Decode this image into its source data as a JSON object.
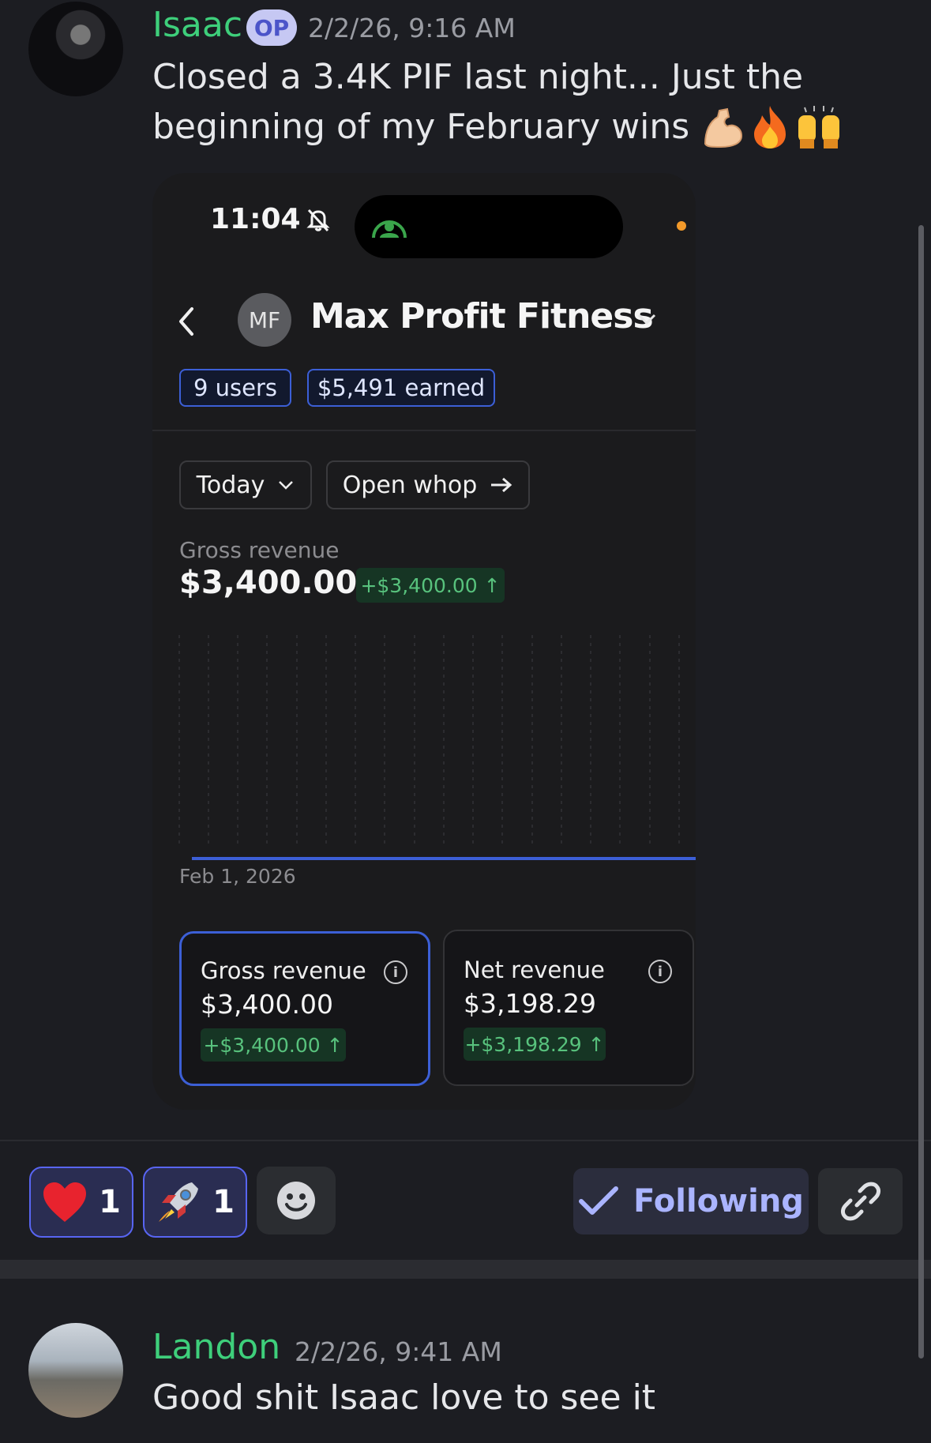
{
  "post": {
    "author": "Isaac",
    "op_badge": "OP",
    "timestamp": "2/2/26, 9:16 AM",
    "text_line1": "Closed a 3.4K PIF last night... Just the",
    "text_line2": "beginning of my February wins",
    "emojis": [
      "flexed-biceps",
      "fire",
      "raising-hands"
    ]
  },
  "phone": {
    "status_time": "11:04",
    "status_icons": [
      "bell-slash-icon",
      "broadcast-icon",
      "recording-dot"
    ],
    "avatar_initials": "MF",
    "business_name": "Max Profit Fitness",
    "users_tag": "9 users",
    "earned_tag": "$5,491 earned",
    "period_dropdown": "Today",
    "open_button": "Open whop",
    "gross_label": "Gross revenue",
    "gross_value": "$3,400.00",
    "gross_change": "+$3,400.00 ↑",
    "chart_date": "Feb 1, 2026",
    "card_gross": {
      "label": "Gross revenue",
      "value": "$3,400.00",
      "change": "+$3,400.00 ↑"
    },
    "card_net": {
      "label": "Net revenue",
      "value": "$3,198.29",
      "change": "+$3,198.29 ↑"
    },
    "colors": {
      "accent": "#3c5fd6",
      "positive": "#58c27d",
      "background": "#1b1b1d"
    }
  },
  "reactions": [
    {
      "emoji": "heart",
      "count": "1"
    },
    {
      "emoji": "rocket",
      "count": "1"
    }
  ],
  "actions": {
    "following_label": "Following"
  },
  "reply": {
    "author": "Landon",
    "timestamp": "2/2/26, 9:41 AM",
    "text": "Good shit Isaac love to see it"
  },
  "colors": {
    "username": "#3ecf7b",
    "blurple": "#5865f2",
    "background": "#1c1d22"
  }
}
